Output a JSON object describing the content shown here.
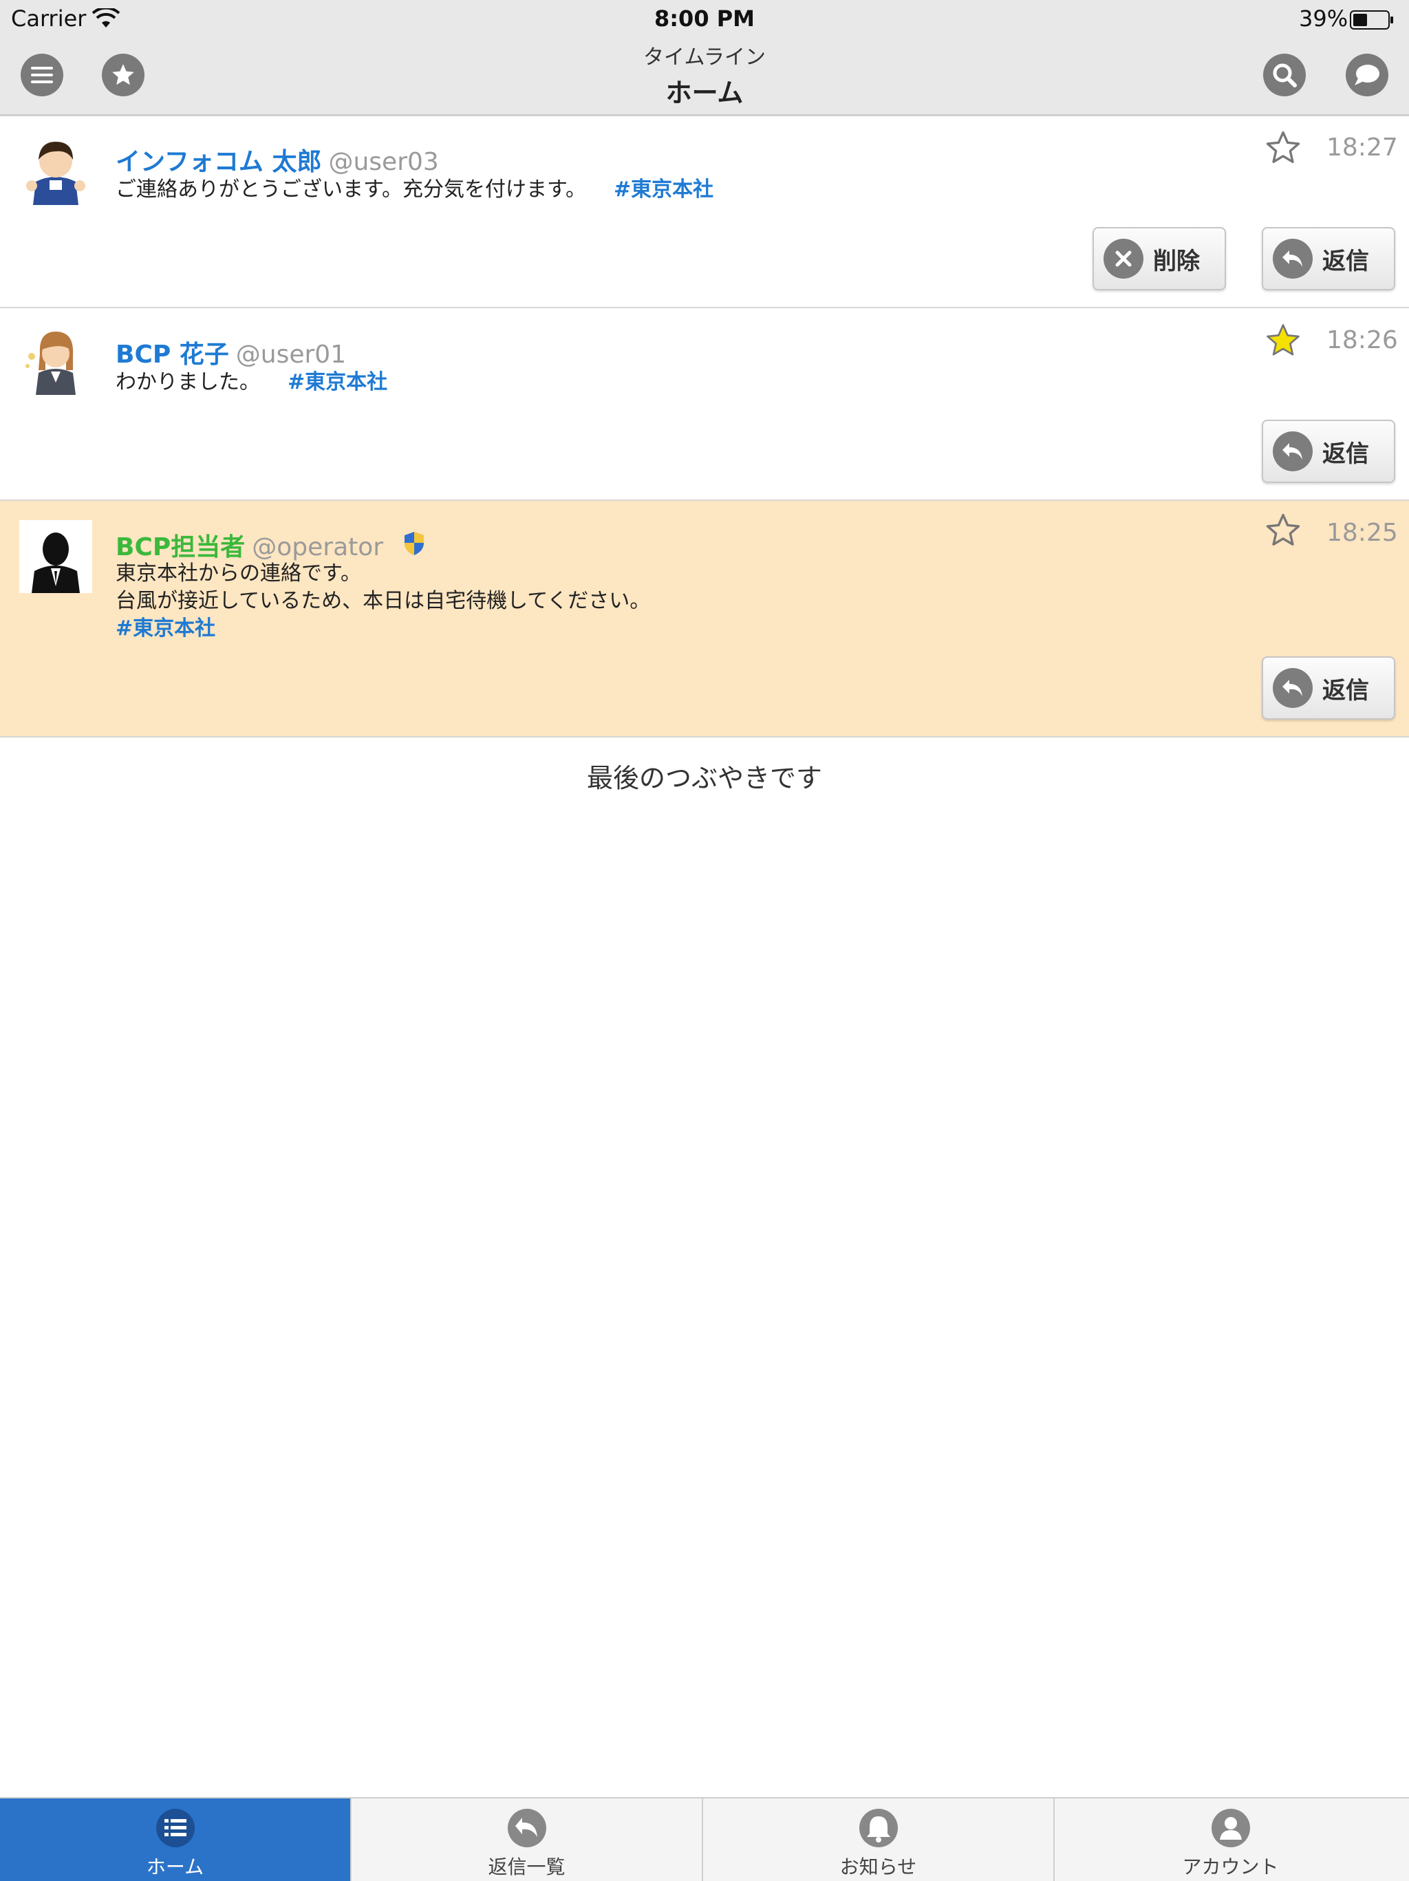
{
  "status_bar": {
    "carrier": "Carrier",
    "time": "8:00 PM",
    "battery": "39%"
  },
  "header": {
    "subtitle": "タイムライン",
    "title": "ホーム"
  },
  "posts": [
    {
      "name": "インフォコム 太郎",
      "handle": "@user03",
      "text": "ご連絡ありがとうございます。充分気を付けます。",
      "hashtag": "#東京本社",
      "time": "18:27",
      "starred": false,
      "delete_label": "削除",
      "reply_label": "返信"
    },
    {
      "name": "BCP 花子",
      "handle": "@user01",
      "text": "わかりました。",
      "hashtag": "#東京本社",
      "time": "18:26",
      "starred": true,
      "reply_label": "返信"
    },
    {
      "name": "BCP担当者",
      "handle": "@operator",
      "text_line1": "東京本社からの連絡です。",
      "text_line2": "台風が接近しているため、本日は自宅待機してください。",
      "hashtag": "#東京本社",
      "time": "18:25",
      "starred": false,
      "reply_label": "返信"
    }
  ],
  "end_message": "最後のつぶやきです",
  "tabs": [
    {
      "label": "ホーム",
      "icon": "list-icon",
      "active": true
    },
    {
      "label": "返信一覧",
      "icon": "reply-icon",
      "active": false
    },
    {
      "label": "お知らせ",
      "icon": "bell-icon",
      "active": false
    },
    {
      "label": "アカウント",
      "icon": "user-icon",
      "active": false
    }
  ],
  "colors": {
    "accent": "#1e7ad3",
    "operator_name": "#3cb83c",
    "highlight_row": "#fde6c2",
    "tab_active": "#2b73c9",
    "star_filled": "#f5e100"
  }
}
